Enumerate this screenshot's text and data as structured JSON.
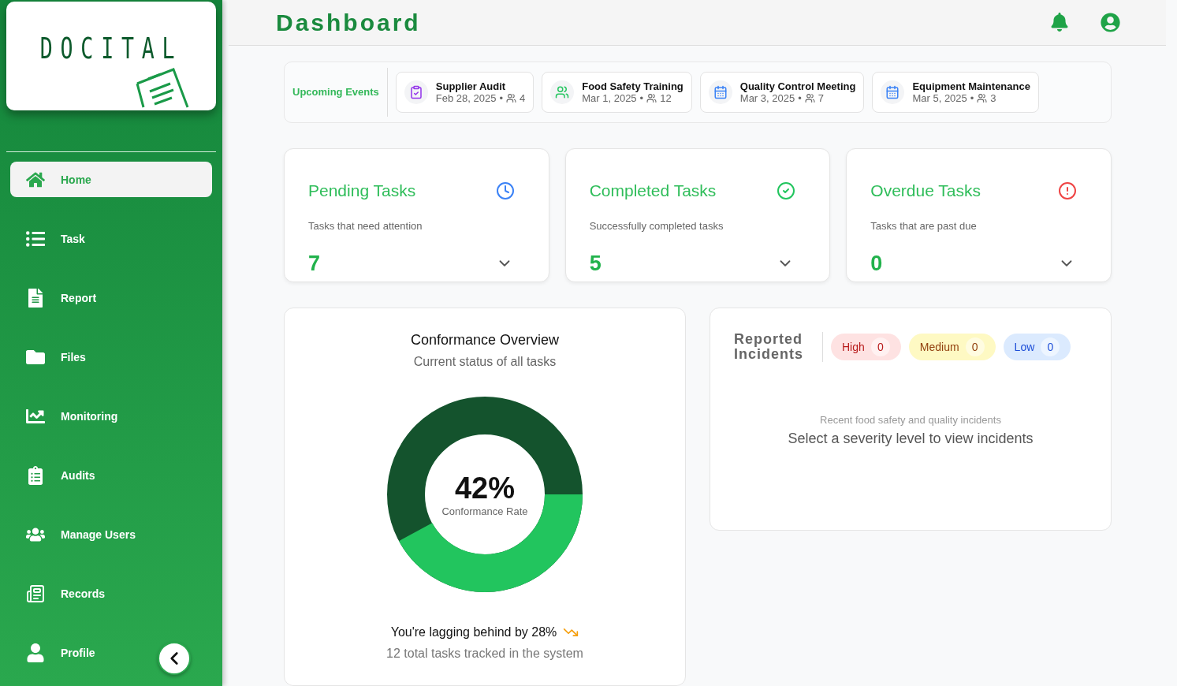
{
  "sidebar": {
    "logo": "DOCITAL",
    "items": [
      {
        "label": "Home",
        "selected": true
      },
      {
        "label": "Task",
        "selected": false
      },
      {
        "label": "Report",
        "selected": false
      },
      {
        "label": "Files",
        "selected": false
      },
      {
        "label": "Monitoring",
        "selected": false
      },
      {
        "label": "Audits",
        "selected": false
      },
      {
        "label": "Manage Users",
        "selected": false
      },
      {
        "label": "Records",
        "selected": false
      },
      {
        "label": "Profile",
        "selected": false
      }
    ]
  },
  "header": {
    "title": "Dashboard"
  },
  "upcoming_events": {
    "label": "Upcoming Events",
    "events": [
      {
        "title": "Supplier Audit",
        "date": "Feb 28, 2025",
        "separator": "•",
        "attendees": "4"
      },
      {
        "title": "Food Safety Training",
        "date": "Mar 1, 2025",
        "separator": "•",
        "attendees": "12"
      },
      {
        "title": "Quality Control Meeting",
        "date": "Mar 3, 2025",
        "separator": "•",
        "attendees": "7"
      },
      {
        "title": "Equipment Maintenance",
        "date": "Mar 5, 2025",
        "separator": "•",
        "attendees": "3"
      }
    ]
  },
  "task_cards": [
    {
      "title": "Pending Tasks",
      "subtitle": "Tasks that need attention",
      "count": "7",
      "expanded": false
    },
    {
      "title": "Completed Tasks",
      "subtitle": "Successfully completed tasks",
      "count": "5",
      "expanded": false
    },
    {
      "title": "Overdue Tasks",
      "subtitle": "Tasks that are past due",
      "count": "0",
      "expanded": false
    }
  ],
  "conformance": {
    "title": "Conformance Overview",
    "subtitle": "Current status of all tasks",
    "level": 0.42,
    "value": "42%",
    "value_label": "Conformance Rate",
    "trend": "You're lagging behind by 28%",
    "footer": "12 total tasks tracked in the system"
  },
  "incidents": {
    "title": "Reported Incidents",
    "filters": [
      {
        "label": "High",
        "count": "0",
        "color": "#fee2e2",
        "selected": false
      },
      {
        "label": "Medium",
        "count": "0",
        "color": "#fef9c3",
        "selected": false
      },
      {
        "label": "Low",
        "count": "0",
        "color": "#dbeafe",
        "selected": false
      }
    ],
    "subtitle": "Recent food safety and quality incidents",
    "message": "Select a severity level to view incidents"
  }
}
